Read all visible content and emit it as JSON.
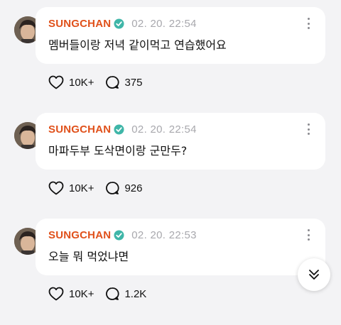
{
  "colors": {
    "author": "#e0511b",
    "verified": "#3fb6a8",
    "timestamp": "#a8a8ad",
    "background": "#f3f3f5",
    "bubble": "#ffffff"
  },
  "posts": [
    {
      "author": "SUNGCHAN",
      "timestamp": "02. 20. 22:54",
      "message": "멤버들이랑 저녁 같이먹고 연습했어요",
      "likes": "10K+",
      "comments": "375"
    },
    {
      "author": "SUNGCHAN",
      "timestamp": "02. 20. 22:54",
      "message": "마파두부 도삭면이랑 군만두?",
      "likes": "10K+",
      "comments": "926"
    },
    {
      "author": "SUNGCHAN",
      "timestamp": "02. 20. 22:53",
      "message": "오늘 뭐 먹었냐면",
      "likes": "10K+",
      "comments": "1.2K"
    }
  ],
  "icons": {
    "verified": "verified-badge-icon",
    "more": "more-vertical-icon",
    "like": "heart-icon",
    "comment": "comment-bubble-icon",
    "scroll": "double-chevron-down-icon",
    "avatar": "profile-photo"
  }
}
